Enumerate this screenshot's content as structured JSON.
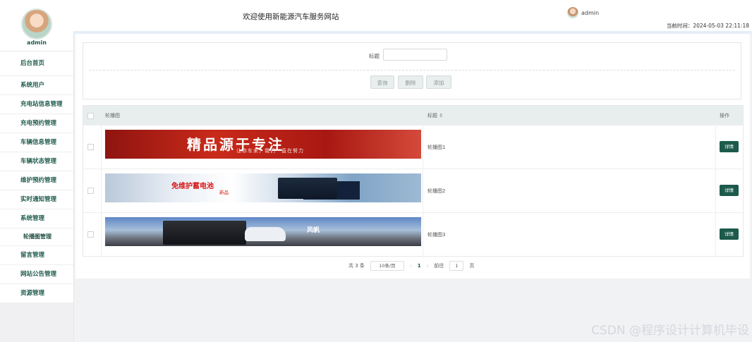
{
  "sidebar": {
    "user": "admin",
    "items": [
      {
        "label": "后台首页"
      },
      {
        "label": "系统用户"
      },
      {
        "label": "充电站信息管理"
      },
      {
        "label": "充电预约管理"
      },
      {
        "label": "车辆信息管理"
      },
      {
        "label": "车辆状态管理"
      },
      {
        "label": "维护预约管理"
      },
      {
        "label": "实时通知管理"
      },
      {
        "label": "系统管理"
      },
      {
        "label": "轮播图管理"
      },
      {
        "label": "留言管理"
      },
      {
        "label": "网站公告管理"
      },
      {
        "label": "资源管理"
      }
    ]
  },
  "header": {
    "title": "欢迎使用新能源汽车服务网站",
    "user": "admin",
    "time_label": "当前时间：2024-05-03 22:11:18"
  },
  "search": {
    "title_label": "标题",
    "title_value": "",
    "buttons": {
      "query": "查询",
      "delete": "删除",
      "add": "添加"
    }
  },
  "table": {
    "headers": {
      "image": "轮播图",
      "title": "标题 ⇳",
      "action": "操作"
    },
    "rows": [
      {
        "title": "轮播图1",
        "banner_text": "精品源于专注",
        "banner_sub": "让你车来，我们一直在努力"
      },
      {
        "title": "轮播图2",
        "banner_text": "免维护蓄电池",
        "banner_sub": "新品"
      },
      {
        "title": "轮播图3",
        "banner_text": "风帆",
        "banner_sub": ""
      }
    ],
    "action_label": "详情"
  },
  "pager": {
    "total": "共 3 条",
    "page_size": "10条/页",
    "prev": "‹",
    "current": "1",
    "next": "›",
    "goto_label": "前往",
    "goto_value": "1",
    "page_unit": "页"
  },
  "watermark": "CSDN @程序设计计算机毕设",
  "colors": {
    "primary": "#1c5a4b",
    "header_bg": "#e8eeee"
  }
}
